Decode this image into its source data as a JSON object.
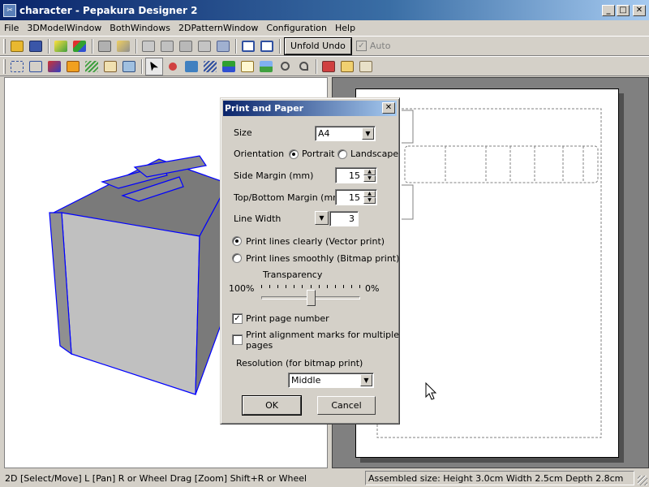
{
  "window": {
    "title": "character - Pepakura Designer 2",
    "minimize": "_",
    "maximize": "□",
    "close": "✕"
  },
  "menu": [
    "File",
    "3DModelWindow",
    "BothWindows",
    "2DPatternWindow",
    "Configuration",
    "Help"
  ],
  "toolbar": {
    "unfold_undo": "Unfold Undo",
    "auto_label": "Auto",
    "auto_checked": true
  },
  "dialog": {
    "title": "Print and Paper",
    "size_label": "Size",
    "size_value": "A4",
    "orientation_label": "Orientation",
    "portrait_label": "Portrait",
    "landscape_label": "Landscape",
    "orientation_selected": "Portrait",
    "side_margin_label": "Side Margin (mm)",
    "side_margin_value": "15",
    "topbottom_margin_label": "Top/Bottom Margin (mm)",
    "topbottom_margin_value": "15",
    "line_width_label": "Line Width",
    "line_width_value": "3",
    "vector_print_label": "Print lines clearly (Vector print)",
    "bitmap_print_label": "Print lines smoothly (Bitmap print)",
    "print_mode_selected": "vector",
    "transparency_label": "Transparency",
    "transparency_min_label": "100%",
    "transparency_max_label": "0%",
    "transparency_fraction": 0.5,
    "page_number_label": "Print page number",
    "page_number_checked": true,
    "alignment_marks_label_1": "Print alignment marks for multiple",
    "alignment_marks_label_2": "pages",
    "alignment_marks_checked": false,
    "resolution_label": "Resolution (for bitmap print)",
    "resolution_value": "Middle",
    "ok_label": "OK",
    "cancel_label": "Cancel"
  },
  "status": {
    "hint": "2D [Select/Move] L [Pan] R or Wheel Drag [Zoom] Shift+R or Wheel",
    "assembled": "Assembled size: Height 3.0cm Width 2.5cm Depth 2.8cm"
  },
  "colors": {
    "model_edge": "#0000ff",
    "model_face": "#c0c0c0",
    "model_dark": "#7a7a7a"
  }
}
